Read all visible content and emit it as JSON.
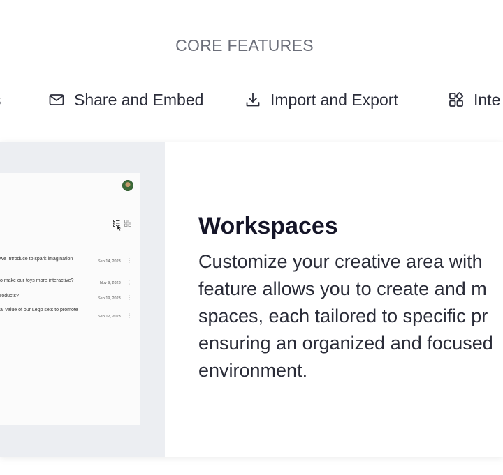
{
  "section_title": "CORE FEATURES",
  "tabs": {
    "prev_label_fragment": "s",
    "share_label": "Share and Embed",
    "import_label": "Import and Export",
    "integrations_label_fragment": "Inte"
  },
  "icons": {
    "share": "envelope-icon",
    "import": "download-icon",
    "integrations": "widgets-icon"
  },
  "card": {
    "heading": "Workspaces",
    "description_lines": [
      "Customize your creative area with",
      "feature allows you to create and m",
      "spaces, each tailored to specific pr",
      "ensuring an organized and focused",
      "environment."
    ]
  },
  "mock": {
    "rows": [
      {
        "question": "we introduce to spark imagination",
        "date": "Sep 14, 2023"
      },
      {
        "question": "o make our toys more interactive?",
        "date": "Nov 9, 2023"
      },
      {
        "question": "roducts?",
        "date": "Sep 19, 2023"
      },
      {
        "question": "al value of our Lego sets to promote",
        "date": "Sep 12, 2023"
      }
    ]
  }
}
